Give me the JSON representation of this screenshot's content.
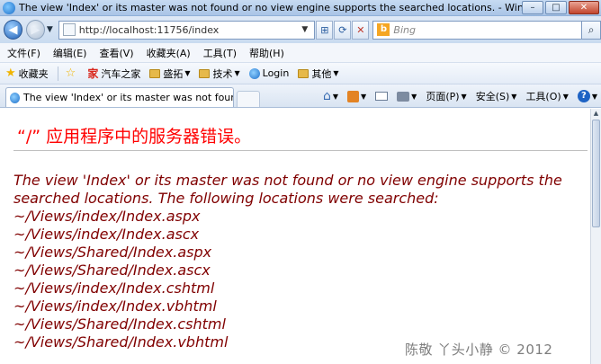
{
  "window": {
    "title": "The view 'Index' or its master was not found or no view engine supports the searched locations. - Windows Inter...",
    "minimize_glyph": "–",
    "maximize_glyph": "□",
    "close_glyph": "✕"
  },
  "address_bar": {
    "url": "http://localhost:11756/index",
    "search_placeholder": "Bing",
    "back_icon": "back-arrow-icon",
    "forward_icon": "forward-arrow-icon"
  },
  "menu": {
    "items": [
      "文件(F)",
      "编辑(E)",
      "查看(V)",
      "收藏夹(A)",
      "工具(T)",
      "帮助(H)"
    ]
  },
  "favorites": {
    "items": [
      {
        "label": "收藏夹",
        "icon": "star-icon"
      },
      {
        "label": "汽车之家",
        "icon": "home-logo-icon"
      },
      {
        "label": "盛拓",
        "icon": "folder-icon"
      },
      {
        "label": "技术",
        "icon": "folder-icon"
      },
      {
        "label": "Login",
        "icon": "ie-page-icon"
      },
      {
        "label": "其他",
        "icon": "folder-icon"
      }
    ]
  },
  "tabs": {
    "active_label": "The view 'Index' or its master was not found..."
  },
  "commands": {
    "page": "页面(P)",
    "safety": "安全(S)",
    "tools": "工具(O)"
  },
  "page": {
    "error_title": "“/” 应用程序中的服务器错误。",
    "error_message": "The view 'Index' or its master was not found or no view engine supports the searched locations. The following locations were searched:",
    "locations": [
      "~/Views/index/Index.aspx",
      "~/Views/index/Index.ascx",
      "~/Views/Shared/Index.aspx",
      "~/Views/Shared/Index.ascx",
      "~/Views/index/Index.cshtml",
      "~/Views/index/Index.vbhtml",
      "~/Views/Shared/Index.cshtml",
      "~/Views/Shared/Index.vbhtml"
    ],
    "error_color": "#800000",
    "title_color": "#ff0000"
  },
  "watermark": "陈敬 丫头小静 © 2012"
}
